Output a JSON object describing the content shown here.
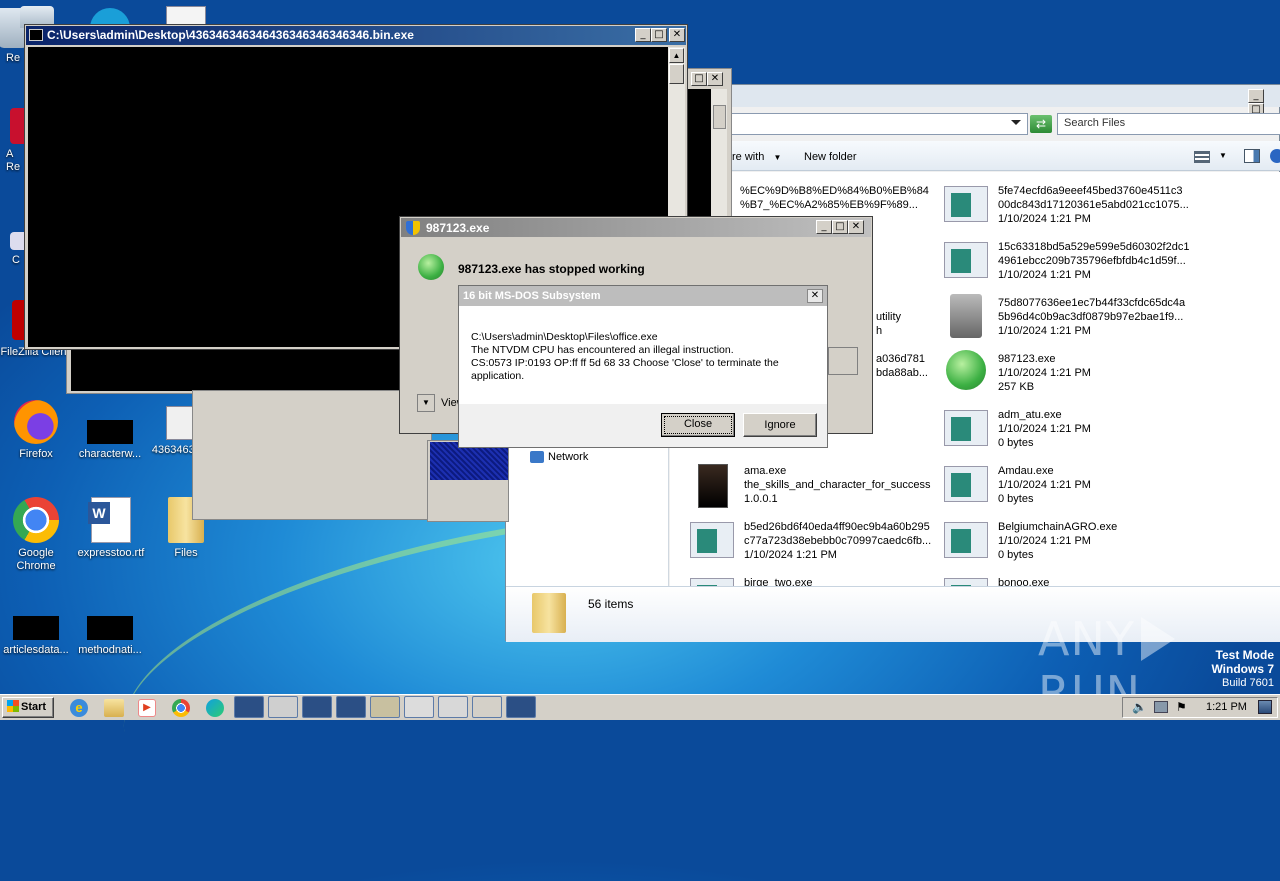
{
  "desktop": {
    "icons": [
      {
        "label": "Re",
        "id": "recycle"
      },
      {
        "label": "A Re",
        "id": "acrobat"
      },
      {
        "label": "C",
        "id": "ccleaner"
      },
      {
        "label": "FileZilla Client",
        "id": "filezilla"
      },
      {
        "label": "Firefox",
        "id": "firefox"
      },
      {
        "label": "characterw...",
        "id": "characterw"
      },
      {
        "label": "436346346...",
        "id": "436346"
      },
      {
        "label": "Google Chrome",
        "id": "chrome"
      },
      {
        "label": "expresstoo.rtf",
        "id": "expresstoo"
      },
      {
        "label": "Files",
        "id": "files"
      },
      {
        "label": "articlesdata...",
        "id": "articlesdata"
      },
      {
        "label": "methodnati...",
        "id": "methodnati"
      }
    ]
  },
  "console_window": {
    "title": "C:\\Users\\admin\\Desktop\\436346346346436346346346346.bin.exe"
  },
  "explorer": {
    "search_placeholder": "Search Files",
    "toolbar": {
      "share_with": "re with",
      "new_folder": "New folder"
    },
    "nav_network": "Network",
    "status": "56 items",
    "left_fragments": [
      "%EC%9D%B8%ED%84%B0%EB%84",
      "%B7_%EC%A2%85%EB%9F%89...",
      "utility",
      "h",
      "a036d781",
      "bda88ab..."
    ],
    "files_col1": [
      {
        "l1": "ama.exe",
        "l2": "the_skills_and_character_for_success",
        "l3": "1.0.0.1"
      },
      {
        "l1": "b5ed26bd6f40eda4ff90ec9b4a60b295",
        "l2": "c77a723d38ebebb0c70997caedc6fb...",
        "l3": "1/10/2024 1:21 PM"
      },
      {
        "l1": "birge_two.exe",
        "l2": "",
        "l3": ""
      }
    ],
    "files_col2": [
      {
        "l1": "5fe74ecfd6a9eeef45bed3760e4511c3",
        "l2": "00dc843d17120361e5abd021cc1075...",
        "l3": "1/10/2024 1:21 PM"
      },
      {
        "l1": "15c63318bd5a529e599e5d60302f2dc1",
        "l2": "4961ebcc209b735796efbfdb4c1d59f...",
        "l3": "1/10/2024 1:21 PM"
      },
      {
        "l1": "75d8077636ee1ec7b44f33cfdc65dc4a",
        "l2": "5b96d4c0b9ac3df0879b97e2bae1f9...",
        "l3": "1/10/2024 1:21 PM"
      },
      {
        "l1": "987123.exe",
        "l2": "1/10/2024 1:21 PM",
        "l3": "257 KB"
      },
      {
        "l1": "adm_atu.exe",
        "l2": "1/10/2024 1:21 PM",
        "l3": "0 bytes"
      },
      {
        "l1": "Amdau.exe",
        "l2": "1/10/2024 1:21 PM",
        "l3": "0 bytes"
      },
      {
        "l1": "BelgiumchainAGRO.exe",
        "l2": "1/10/2024 1:21 PM",
        "l3": "0 bytes"
      },
      {
        "l1": "bonoo.exe",
        "l2": "",
        "l3": ""
      }
    ]
  },
  "crash_dialog": {
    "title": "987123.exe",
    "message": "987123.exe has stopped working",
    "view_label": "View"
  },
  "ntvdm_dialog": {
    "title": "16 bit MS-DOS Subsystem",
    "line1": "C:\\Users\\admin\\Desktop\\Files\\office.exe",
    "line2": "The NTVDM CPU has encountered an illegal instruction.",
    "line3": "CS:0573 IP:0193 OP:ff ff 5d 68 33 Choose 'Close' to terminate the",
    "line4": "application.",
    "close_label": "Close",
    "ignore_label": "Ignore"
  },
  "watermark": {
    "left": "ANY",
    "right": "RUN"
  },
  "os_badge": {
    "line1": "Test Mode",
    "line2": "Windows 7",
    "line3": "Build 7601"
  },
  "taskbar": {
    "start_label": "Start",
    "clock": "1:21 PM"
  },
  "colors": {
    "titlebar": "#0a246a",
    "accent": "#3a6ea5",
    "ok_green": "#3cb043"
  }
}
